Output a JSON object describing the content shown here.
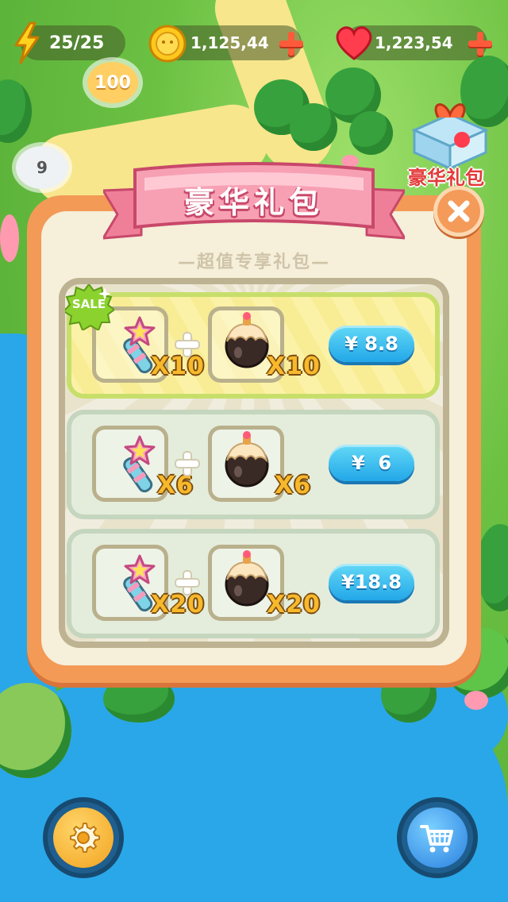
{
  "hud": {
    "energy": "25/25",
    "coins": "1,125,44",
    "hearts": "1,223,54"
  },
  "map": {
    "level_top": "100",
    "level_left": "9"
  },
  "event": {
    "label": "豪华礼包"
  },
  "dialog": {
    "title": "豪华礼包",
    "subtitle": "—超值专享礼包—",
    "sale_badge": "SALE",
    "packs": [
      {
        "item1_qty": "X10",
        "item2_qty": "X10",
        "price": "¥ 8.8",
        "highlight": true
      },
      {
        "item1_qty": "X6",
        "item2_qty": "X6",
        "price": "¥  6",
        "highlight": false
      },
      {
        "item1_qty": "X20",
        "item2_qty": "X20",
        "price": "¥18.8",
        "highlight": false
      }
    ]
  },
  "icons": {
    "energy": "lightning-icon",
    "coins": "coin-icon",
    "hearts": "heart-icon",
    "wand": "star-wand-icon",
    "bomb": "bomb-icon",
    "close": "close-icon",
    "settings": "gear-icon",
    "shop": "cart-icon"
  },
  "colors": {
    "dialog_frame": "#f39a57",
    "dialog_panel": "#f6efda",
    "banner": "#f4879d",
    "price_button": "#22a7e8",
    "quantity_text": "#f7b92c",
    "sale_badge": "#8bd22f"
  }
}
